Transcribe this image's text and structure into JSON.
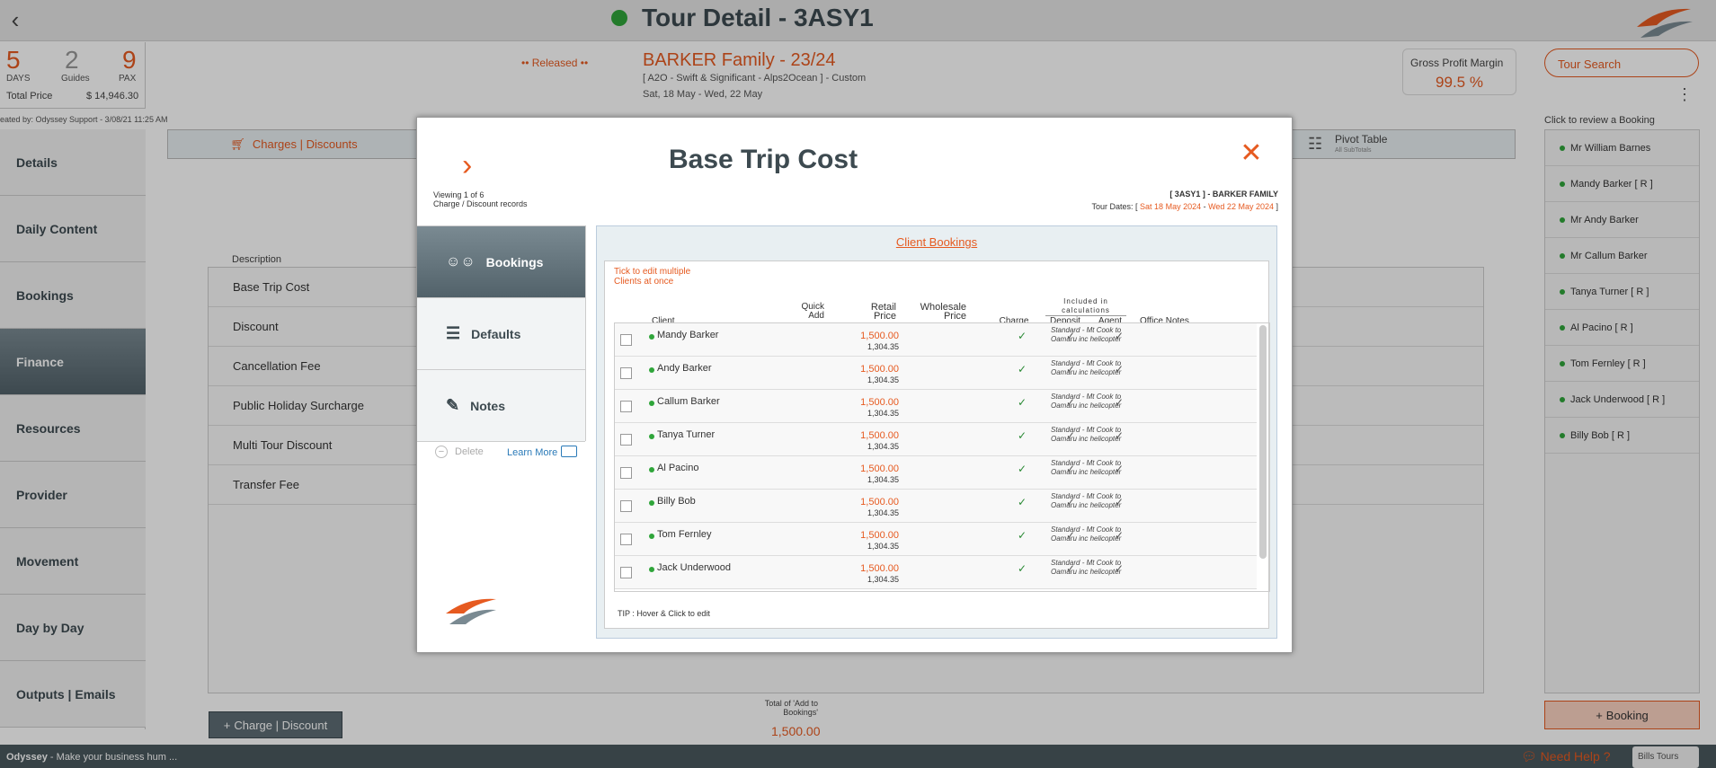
{
  "header": {
    "title": "Tour Detail - 3ASY1"
  },
  "stats": {
    "days": "5",
    "days_label": "DAYS",
    "guides": "2",
    "guides_label": "Guides",
    "pax": "9",
    "pax_label": "PAX",
    "total_price_label": "Total Price",
    "total_price": "$ 14,946.30"
  },
  "tour": {
    "released": "•• Released ••",
    "family": "BARKER Family - 23/24",
    "subline": "[ A2O - Swift & Significant - Alps2Ocean ] - Custom",
    "dates": "Sat, 18 May  - Wed, 22 May"
  },
  "gross_profit": {
    "label": "Gross Profit Margin",
    "value": "99.5 %"
  },
  "tour_search": {
    "placeholder": "Tour Search"
  },
  "created_by": "eated by: Odyssey Support - 3/08/21 11:25 AM",
  "nav": [
    "Details",
    "Daily Content",
    "Bookings",
    "Finance",
    "Resources",
    "Provider",
    "Movement",
    "Day by Day",
    "Outputs | Emails"
  ],
  "charges": {
    "tab": "Charges | Discounts",
    "pivot": "Pivot Table",
    "pivot_sub": "All SubTotals"
  },
  "description_header": "Description",
  "descriptions": [
    "Base Trip Cost",
    "Discount",
    "Cancellation Fee",
    "Public Holiday Surcharge",
    "Multi Tour Discount",
    "Transfer Fee"
  ],
  "add_charge": "Charge | Discount",
  "total_add_label": "Total of 'Add to Bookings'",
  "total_add_value": "1,500.00",
  "right_panel": {
    "heading": "Click to review a Booking",
    "bookings": [
      "Mr William Barnes",
      "Mandy Barker  [ R ]",
      "Mr Andy Barker",
      "Mr Callum Barker",
      "Tanya Turner  [ R ]",
      "Al Pacino  [ R ]",
      "Tom Fernley  [ R ]",
      "Jack Underwood  [ R ]",
      "Billy Bob  [ R ]"
    ],
    "add_booking": "Booking"
  },
  "footer": {
    "app": "Odyssey",
    "tagline": " - Make your business hum ...",
    "help": "Need Help ?",
    "brand": "Bills Tours"
  },
  "modal": {
    "title": "Base Trip Cost",
    "viewing": "Viewing 1 of 6",
    "viewing_sub": "Charge / Discount records",
    "tour_id": "[ 3ASY1 ] - BARKER FAMILY",
    "tour_dates_prefix": "Tour Dates: [ ",
    "tour_date_from": "Sat 18 May 2024",
    "tour_date_sep": " - ",
    "tour_date_to": "Wed 22 May 2024",
    "tour_dates_suffix": " ]",
    "tabs": [
      "Bookings",
      "Defaults",
      "Notes"
    ],
    "delete": "Delete",
    "learn_more": "Learn More",
    "section_title": "Client Bookings",
    "tick_note_1": "Tick to edit multiple",
    "tick_note_2": "Clients at once",
    "columns": {
      "client": "Client",
      "quick_add": "Quick Add",
      "retail": "Retail Price",
      "wholesale": "Wholesale Price",
      "charge": "Charge",
      "included": "Included in calculations",
      "deposit": "Deposit",
      "agent": "Agent",
      "notes": "Office Notes"
    },
    "clients": [
      {
        "name": "Mandy Barker",
        "retail": "1,500.00",
        "net": "1,304.35",
        "notes": "Standard - Mt Cook to Oamaru inc helicopter"
      },
      {
        "name": "Andy Barker",
        "retail": "1,500.00",
        "net": "1,304.35",
        "notes": "Standard - Mt Cook to Oamaru inc helicopter"
      },
      {
        "name": "Callum Barker",
        "retail": "1,500.00",
        "net": "1,304.35",
        "notes": "Standard - Mt Cook to Oamaru inc helicopter"
      },
      {
        "name": "Tanya Turner",
        "retail": "1,500.00",
        "net": "1,304.35",
        "notes": "Standard - Mt Cook to Oamaru inc helicopter"
      },
      {
        "name": "Al Pacino",
        "retail": "1,500.00",
        "net": "1,304.35",
        "notes": "Standard - Mt Cook to Oamaru inc helicopter"
      },
      {
        "name": "Billy Bob",
        "retail": "1,500.00",
        "net": "1,304.35",
        "notes": "Standard - Mt Cook to Oamaru inc helicopter"
      },
      {
        "name": "Tom Fernley",
        "retail": "1,500.00",
        "net": "1,304.35",
        "notes": "Standard - Mt Cook to Oamaru inc helicopter"
      },
      {
        "name": "Jack Underwood",
        "retail": "1,500.00",
        "net": "1,304.35",
        "notes": "Standard - Mt Cook to Oamaru inc helicopter"
      }
    ],
    "tip": "TIP : Hover & Click to edit"
  },
  "colors": {
    "accent": "#e65a20",
    "status_green": "#2fa53a",
    "nav_active": "#52626a"
  }
}
